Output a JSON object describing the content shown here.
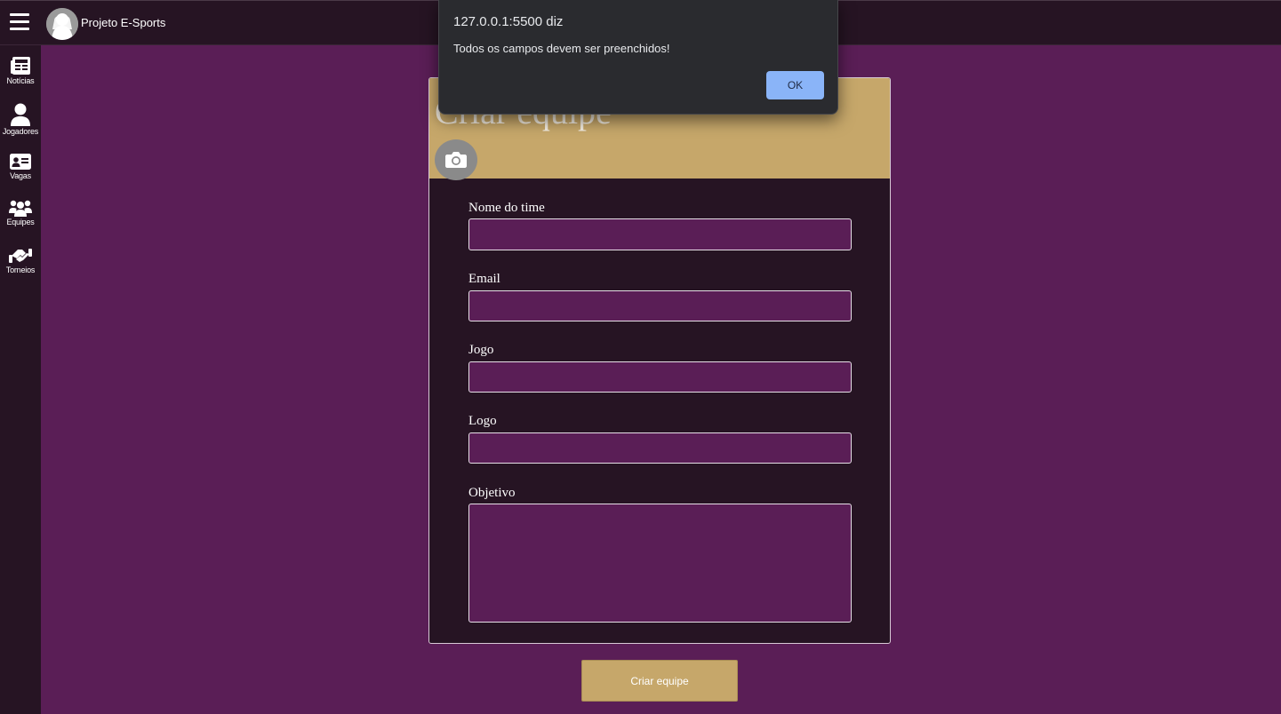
{
  "header": {
    "menu_icon": "hamburger-menu-icon",
    "avatar_icon": "user-avatar-icon",
    "title": "Projeto E-Sports"
  },
  "sidebar": {
    "items": [
      {
        "label": "Notícias",
        "icon": "newspaper-icon"
      },
      {
        "label": "Jogadores",
        "icon": "user-icon"
      },
      {
        "label": "Vagas",
        "icon": "id-card-icon"
      },
      {
        "label": "Equipes",
        "icon": "users-group-icon"
      },
      {
        "label": "Torneios",
        "icon": "handshake-icon"
      }
    ]
  },
  "form": {
    "title": "Criar equipe",
    "camera_icon": "camera-icon",
    "fields": {
      "name_label": "Nome do time",
      "name_value": "",
      "email_label": "Email",
      "email_value": "",
      "game_label": "Jogo",
      "game_value": "",
      "logo_label": "Logo",
      "logo_value": "",
      "objective_label": "Objetivo",
      "objective_value": ""
    },
    "submit_label": "Criar equipe"
  },
  "dialog": {
    "origin": "127.0.0.1:5500 diz",
    "message": "Todos os campos devem ser preenchidos!",
    "ok_label": "OK"
  },
  "colors": {
    "page_background": "#5a1e56",
    "panel_dark": "#261423",
    "accent_gold": "#c6a76a",
    "dialog_background": "#2a2b2f",
    "dialog_button": "#8ab4f8"
  }
}
